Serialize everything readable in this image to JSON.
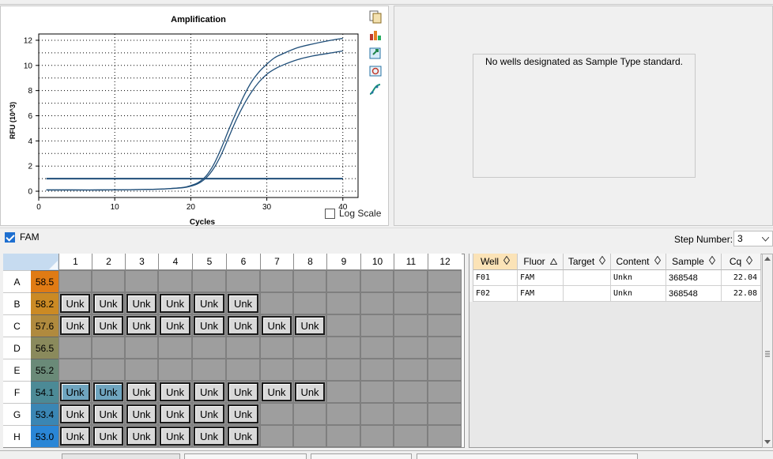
{
  "chart": {
    "title": "Amplification",
    "xlabel": "Cycles",
    "ylabel": "RFU (10^3)",
    "log_scale_label": "Log Scale",
    "log_scale_checked": false
  },
  "chart_data": {
    "type": "line",
    "title": "Amplification",
    "xlabel": "Cycles",
    "ylabel": "RFU (10^3)",
    "xlim": [
      0,
      42
    ],
    "ylim": [
      -0.5,
      12.5
    ],
    "xticks": [
      0,
      10,
      20,
      30,
      40
    ],
    "yticks": [
      0,
      2,
      4,
      6,
      8,
      10,
      12
    ],
    "grid": true,
    "series": [
      {
        "x": [
          1,
          4,
          8,
          12,
          15,
          17,
          19,
          20,
          21,
          22,
          23,
          24,
          25,
          26,
          27,
          28,
          29,
          30,
          31,
          32,
          34,
          36,
          38,
          40
        ],
        "values": [
          0.1,
          0.1,
          0.1,
          0.12,
          0.15,
          0.2,
          0.3,
          0.45,
          0.7,
          1.2,
          2.1,
          3.4,
          4.9,
          6.3,
          7.6,
          8.7,
          9.5,
          10.1,
          10.6,
          10.9,
          11.4,
          11.7,
          11.95,
          12.15
        ]
      },
      {
        "x": [
          1,
          4,
          8,
          12,
          15,
          17,
          19,
          20,
          21,
          22,
          23,
          24,
          25,
          26,
          27,
          28,
          29,
          30,
          31,
          32,
          34,
          36,
          38,
          40
        ],
        "values": [
          0.1,
          0.1,
          0.1,
          0.12,
          0.15,
          0.2,
          0.28,
          0.4,
          0.62,
          1.05,
          1.8,
          2.9,
          4.3,
          5.7,
          6.9,
          7.9,
          8.7,
          9.3,
          9.7,
          10.0,
          10.45,
          10.75,
          10.95,
          11.15
        ]
      }
    ],
    "threshold": 1.0,
    "colors": {
      "curve": "#1f4e79",
      "threshold": "#1f4e79"
    }
  },
  "std_panel": {
    "message": "No wells designated as Sample Type standard."
  },
  "fluor": {
    "label": "FAM",
    "checked": true
  },
  "step": {
    "label": "Step Number:",
    "value": "3"
  },
  "plate": {
    "columns": [
      "1",
      "2",
      "3",
      "4",
      "5",
      "6",
      "7",
      "8",
      "9",
      "10",
      "11",
      "12"
    ],
    "rows": [
      {
        "label": "A",
        "temp": "58.5",
        "color": "#e07b14",
        "wells": []
      },
      {
        "label": "B",
        "temp": "58.2",
        "color": "#cb8a24",
        "wells": [
          "Unk",
          "Unk",
          "Unk",
          "Unk",
          "Unk",
          "Unk"
        ]
      },
      {
        "label": "C",
        "temp": "57.6",
        "color": "#b08a3e",
        "wells": [
          "Unk",
          "Unk",
          "Unk",
          "Unk",
          "Unk",
          "Unk",
          "Unk",
          "Unk"
        ]
      },
      {
        "label": "D",
        "temp": "56.5",
        "color": "#8a8a5c",
        "wells": []
      },
      {
        "label": "E",
        "temp": "55.2",
        "color": "#6a8a78",
        "wells": []
      },
      {
        "label": "F",
        "temp": "54.1",
        "color": "#4c8a96",
        "wells": [
          "Unk",
          "Unk",
          "Unk",
          "Unk",
          "Unk",
          "Unk",
          "Unk",
          "Unk"
        ],
        "selected": [
          0,
          1
        ]
      },
      {
        "label": "G",
        "temp": "53.4",
        "color": "#3a86b4",
        "wells": [
          "Unk",
          "Unk",
          "Unk",
          "Unk",
          "Unk",
          "Unk"
        ]
      },
      {
        "label": "H",
        "temp": "53.0",
        "color": "#2a86d6",
        "wells": [
          "Unk",
          "Unk",
          "Unk",
          "Unk",
          "Unk",
          "Unk"
        ]
      }
    ]
  },
  "results": {
    "headers": [
      "Well",
      "Fluor",
      "Target",
      "Content",
      "Sample",
      "Cq"
    ],
    "rows": [
      {
        "well": "F01",
        "fluor": "FAM",
        "target": "",
        "content": "Unkn",
        "sample": "368548",
        "cq": "22.04"
      },
      {
        "well": "F02",
        "fluor": "FAM",
        "target": "",
        "content": "Unkn",
        "sample": "368548",
        "cq": "22.08"
      }
    ]
  },
  "icons": [
    "copy-icon",
    "chart-settings-icon",
    "export-icon",
    "zoom-icon",
    "curve-fit-icon"
  ]
}
